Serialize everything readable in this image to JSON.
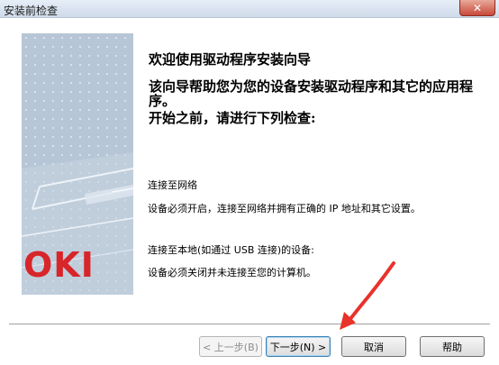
{
  "window": {
    "title": "安装前检查",
    "close_glyph": "✕"
  },
  "art": {
    "logo": "OKI",
    "logo_color": "#d8252a",
    "panel_color": "#b7c6d6"
  },
  "content": {
    "heading_welcome": "欢迎使用驱动程序安装向导",
    "heading_purpose": "该向导帮助您为您的设备安装驱动程序和其它的应用程序。",
    "heading_check": "开始之前，请进行下列检查:",
    "network_title": "连接至网络",
    "network_desc": "设备必须开启，连接至网络并拥有正确的 IP 地址和其它设置。",
    "local_title": "连接至本地(如通过 USB 连接)的设备:",
    "local_desc": "设备必须关闭并未连接至您的计算机。"
  },
  "buttons": {
    "back": "< 上一步(B)",
    "next": "下一步(N) >",
    "cancel": "取消",
    "help": "帮助"
  },
  "annotation": {
    "arrow_color": "#e8322b"
  }
}
